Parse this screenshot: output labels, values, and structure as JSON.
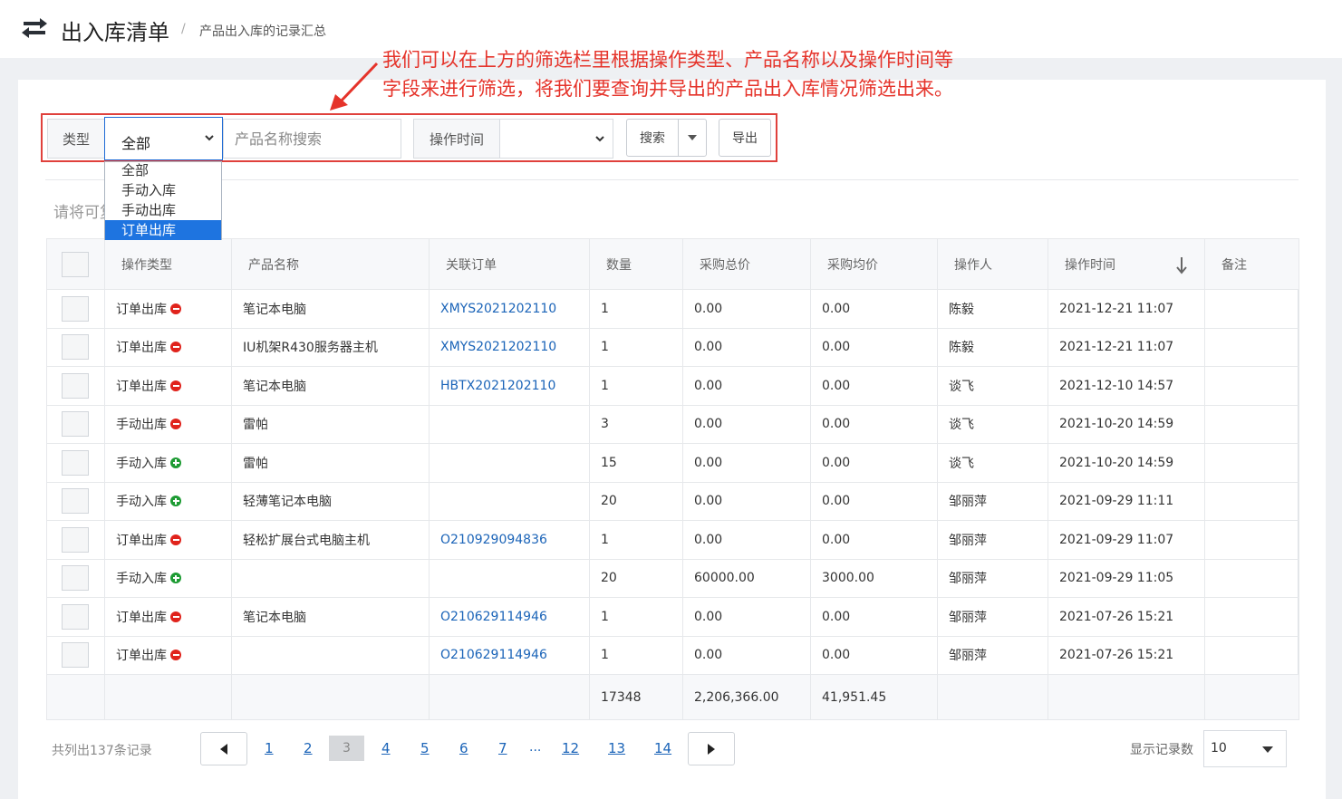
{
  "header": {
    "title": "出入库清单",
    "separator": "/",
    "subtitle": "产品出入库的记录汇总"
  },
  "annotation": {
    "line1": "我们可以在上方的筛选栏里根据操作类型、产品名称以及操作时间等",
    "line2": "字段来进行筛选，将我们要查询并导出的产品出入库情况筛选出来。"
  },
  "filters": {
    "type_label": "类型",
    "type_value": "全部",
    "type_options": [
      "全部",
      "手动入库",
      "手动出库",
      "订单出库"
    ],
    "type_highlighted_index": 3,
    "name_placeholder": "产品名称搜索",
    "time_label": "操作时间",
    "time_value": "",
    "search_label": "搜索",
    "export_label": "导出"
  },
  "hint": "请将可复制的清单",
  "table": {
    "columns": [
      "操作类型",
      "产品名称",
      "关联订单",
      "数量",
      "采购总价",
      "采购均价",
      "操作人",
      "操作时间",
      "备注"
    ],
    "rows": [
      {
        "type": "订单出库",
        "dir": "out",
        "product": "笔记本电脑",
        "order": "XMYS2021202110",
        "qty": "1",
        "total": "0.00",
        "avg": "0.00",
        "operator": "陈毅",
        "time": "2021-12-21 11:07",
        "note": ""
      },
      {
        "type": "订单出库",
        "dir": "out",
        "product": "IU机架R430服务器主机",
        "order": "XMYS2021202110",
        "qty": "1",
        "total": "0.00",
        "avg": "0.00",
        "operator": "陈毅",
        "time": "2021-12-21 11:07",
        "note": ""
      },
      {
        "type": "订单出库",
        "dir": "out",
        "product": "笔记本电脑",
        "order": "HBTX2021202110",
        "qty": "1",
        "total": "0.00",
        "avg": "0.00",
        "operator": "谈飞",
        "time": "2021-12-10 14:57",
        "note": ""
      },
      {
        "type": "手动出库",
        "dir": "out",
        "product": "雷帕",
        "order": "",
        "qty": "3",
        "total": "0.00",
        "avg": "0.00",
        "operator": "谈飞",
        "time": "2021-10-20 14:59",
        "note": ""
      },
      {
        "type": "手动入库",
        "dir": "in",
        "product": "雷帕",
        "order": "",
        "qty": "15",
        "total": "0.00",
        "avg": "0.00",
        "operator": "谈飞",
        "time": "2021-10-20 14:59",
        "note": ""
      },
      {
        "type": "手动入库",
        "dir": "in",
        "product": "轻薄笔记本电脑",
        "order": "",
        "qty": "20",
        "total": "0.00",
        "avg": "0.00",
        "operator": "邹丽萍",
        "time": "2021-09-29 11:11",
        "note": ""
      },
      {
        "type": "订单出库",
        "dir": "out",
        "product": "轻松扩展台式电脑主机",
        "order": "O210929094836",
        "qty": "1",
        "total": "0.00",
        "avg": "0.00",
        "operator": "邹丽萍",
        "time": "2021-09-29 11:07",
        "note": ""
      },
      {
        "type": "手动入库",
        "dir": "in",
        "product": "",
        "order": "",
        "qty": "20",
        "total": "60000.00",
        "avg": "3000.00",
        "operator": "邹丽萍",
        "time": "2021-09-29 11:05",
        "note": ""
      },
      {
        "type": "订单出库",
        "dir": "out",
        "product": "笔记本电脑",
        "order": "O210629114946",
        "qty": "1",
        "total": "0.00",
        "avg": "0.00",
        "operator": "邹丽萍",
        "time": "2021-07-26 15:21",
        "note": ""
      },
      {
        "type": "订单出库",
        "dir": "out",
        "product": "",
        "order": "O210629114946",
        "qty": "1",
        "total": "0.00",
        "avg": "0.00",
        "operator": "邹丽萍",
        "time": "2021-07-26 15:21",
        "note": ""
      }
    ],
    "totals": {
      "qty": "17348",
      "total": "2,206,366.00",
      "avg": "41,951.45"
    }
  },
  "footer": {
    "record_count": "共列出137条记录",
    "pages": [
      "1",
      "2",
      "4",
      "5",
      "6",
      "7",
      "12",
      "13",
      "14"
    ],
    "current_page": "3",
    "ellipsis": "...",
    "page_size_label": "显示记录数",
    "page_size": "10"
  },
  "colors": {
    "accent": "#1e74e0",
    "annotation": "#e5332a",
    "link": "#1b64b8",
    "out": "#e0231c",
    "in": "#1d9b33"
  }
}
